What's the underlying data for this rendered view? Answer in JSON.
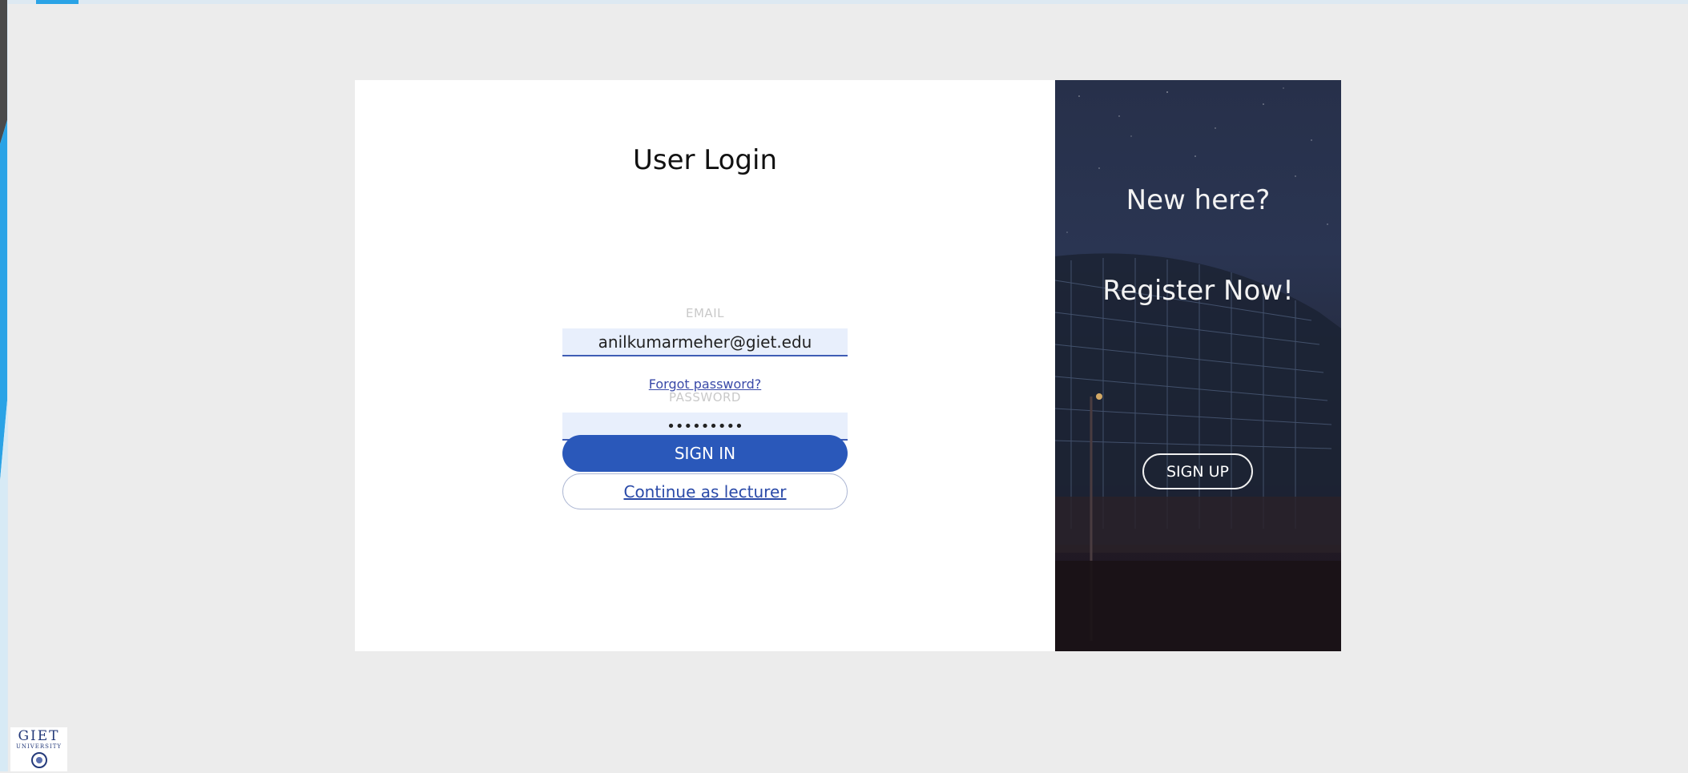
{
  "login": {
    "title": "User Login",
    "email_label": "EMAIL",
    "email_value": "anilkumarmeher@giet.edu",
    "password_label": "PASSWORD",
    "password_value": "•••••••••",
    "forgot_link": "Forgot password?",
    "signin_button": "SIGN IN",
    "lecturer_button": "Continue as lecturer"
  },
  "promo": {
    "heading1": "New here?",
    "heading2": "Register Now!",
    "signup_button": "SIGN UP"
  },
  "logo": {
    "line1": "GIET",
    "line2": "UNIVERSITY"
  },
  "colors": {
    "primary": "#2a58ba",
    "field_bg": "#e8effc",
    "page_bg": "#ececec"
  }
}
